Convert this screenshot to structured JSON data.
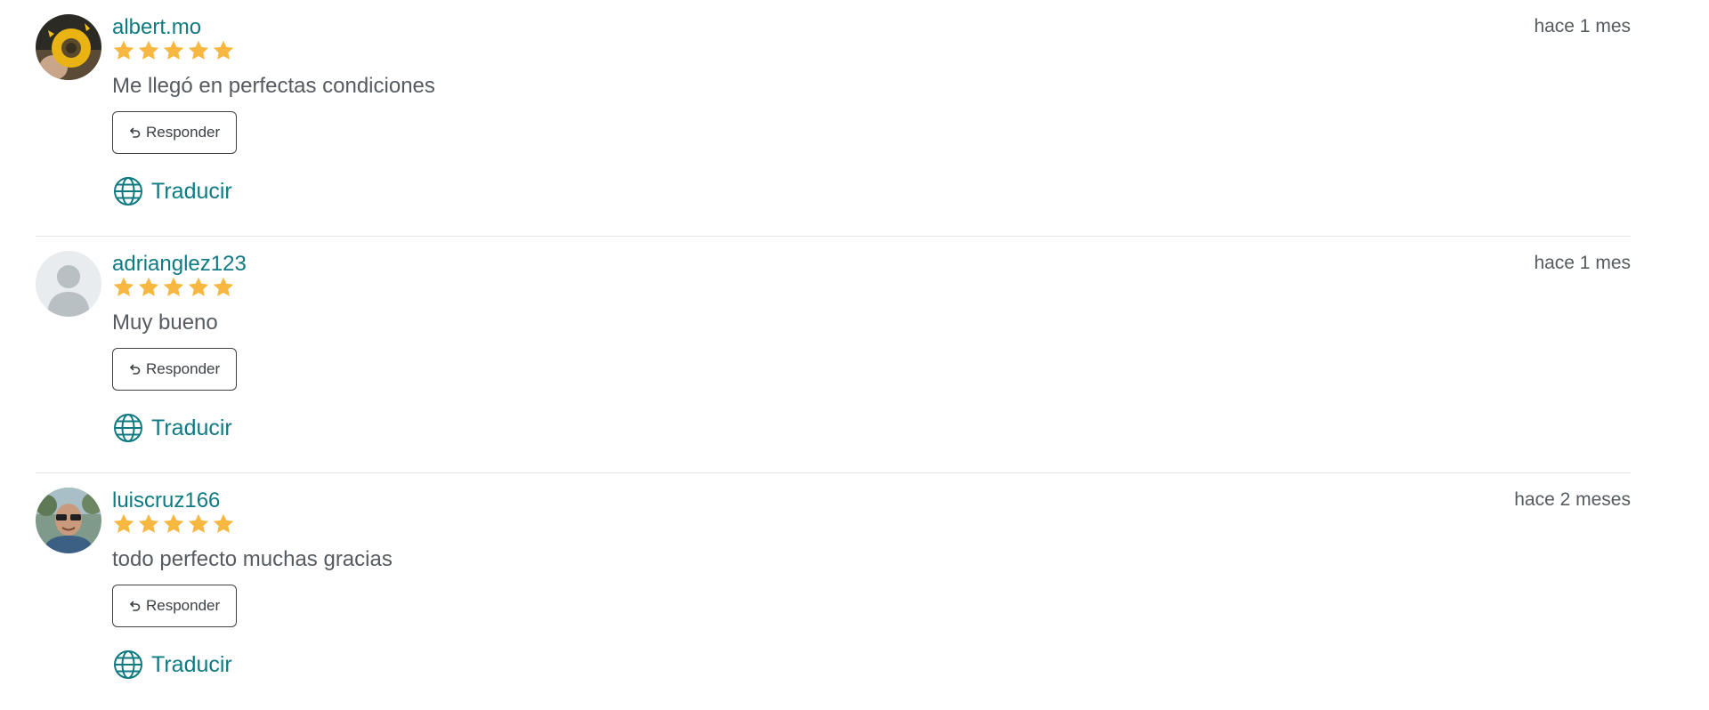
{
  "colors": {
    "username": "#0f7a82",
    "star": "#f7b740",
    "text": "#555b60",
    "divider": "#e4e6e8"
  },
  "reviews": [
    {
      "username": "albert.mo",
      "rating": 5,
      "time": "hace 1 mes",
      "comment": "Me llegó en perfectas condiciones",
      "reply_label": "Responder",
      "translate_label": "Traducir",
      "avatar": "user-photo-sunflower"
    },
    {
      "username": "adrianglez123",
      "rating": 5,
      "time": "hace 1 mes",
      "comment": "Muy bueno",
      "reply_label": "Responder",
      "translate_label": "Traducir",
      "avatar": "default-user-silhouette"
    },
    {
      "username": "luiscruz166",
      "rating": 5,
      "time": "hace 2 meses",
      "comment": "todo perfecto muchas gracias",
      "reply_label": "Responder",
      "translate_label": "Traducir",
      "avatar": "user-photo-man-sunglasses"
    }
  ]
}
